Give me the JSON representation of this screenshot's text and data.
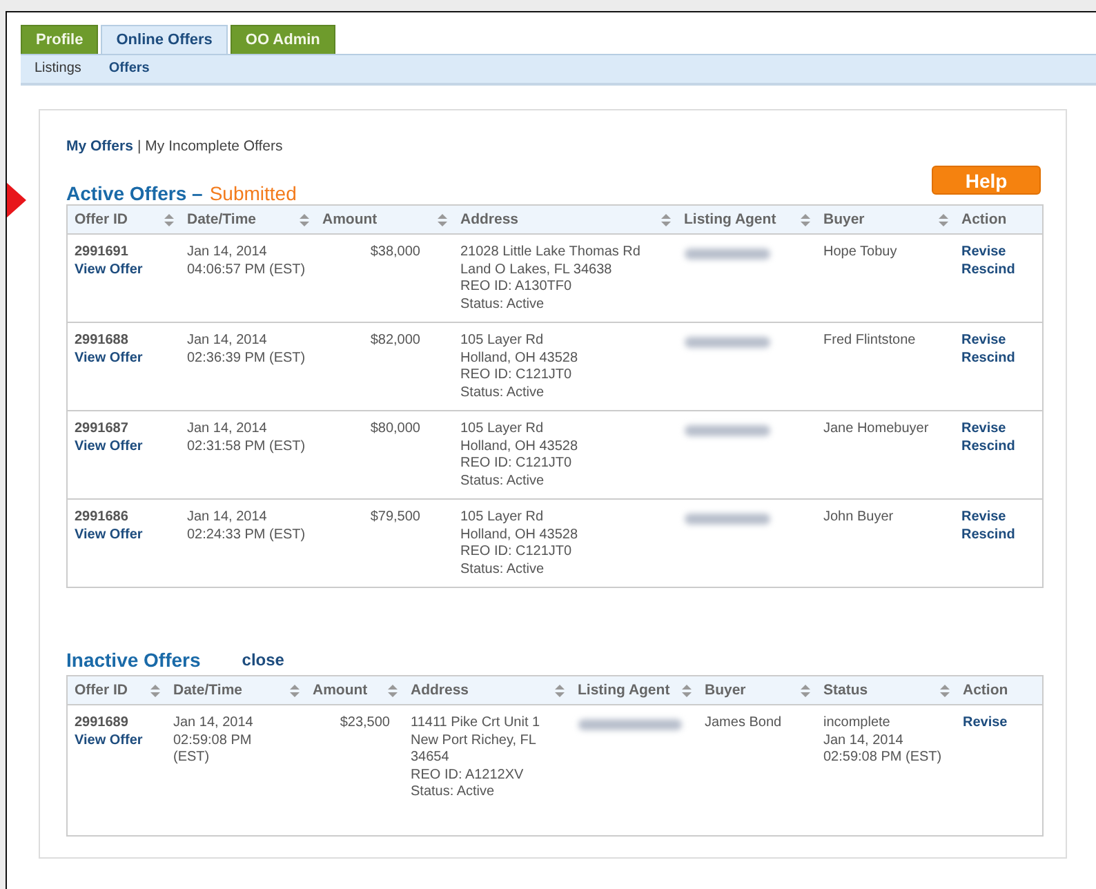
{
  "tabs": [
    {
      "label": "Profile",
      "selected": false
    },
    {
      "label": "Online Offers",
      "selected": true
    },
    {
      "label": "OO Admin",
      "selected": false
    }
  ],
  "subnav": [
    {
      "label": "Listings",
      "selected": false
    },
    {
      "label": "Offers",
      "selected": true
    }
  ],
  "offer_links": [
    {
      "label": "My Offers",
      "selected": true
    },
    {
      "label": "My Incomplete Offers",
      "selected": false
    }
  ],
  "separator": "|",
  "help_button": "Help",
  "active": {
    "title": "Active Offers –",
    "subtitle": "Submitted",
    "columns": [
      {
        "label": "Offer ID",
        "sortable": true
      },
      {
        "label": "Date/Time",
        "sortable": true
      },
      {
        "label": "Amount",
        "sortable": true
      },
      {
        "label": "Address",
        "sortable": true
      },
      {
        "label": "Listing Agent",
        "sortable": true
      },
      {
        "label": "Buyer",
        "sortable": true
      },
      {
        "label": "Action",
        "sortable": false
      }
    ],
    "rows": [
      {
        "offer_id": "2991691",
        "link": "View Offer",
        "date": [
          "Jan 14, 2014",
          "04:06:57 PM (EST)"
        ],
        "amount": "$38,000",
        "address": [
          "21028 Little Lake Thomas Rd",
          "Land O Lakes, FL 34638",
          "REO ID: A130TF0",
          "Status: Active"
        ],
        "buyer": "Hope Tobuy",
        "actions": [
          "Revise",
          "Rescind"
        ]
      },
      {
        "offer_id": "2991688",
        "link": "View Offer",
        "date": [
          "Jan 14, 2014",
          "02:36:39 PM (EST)"
        ],
        "amount": "$82,000",
        "address": [
          "105 Layer Rd",
          "Holland, OH 43528",
          "REO ID: C121JT0",
          "Status: Active"
        ],
        "buyer": "Fred Flintstone",
        "actions": [
          "Revise",
          "Rescind"
        ]
      },
      {
        "offer_id": "2991687",
        "link": "View Offer",
        "date": [
          "Jan 14, 2014",
          "02:31:58 PM (EST)"
        ],
        "amount": "$80,000",
        "address": [
          "105 Layer Rd",
          "Holland, OH 43528",
          "REO ID: C121JT0",
          "Status: Active"
        ],
        "buyer": "Jane Homebuyer",
        "actions": [
          "Revise",
          "Rescind"
        ]
      },
      {
        "offer_id": "2991686",
        "link": "View Offer",
        "date": [
          "Jan 14, 2014",
          "02:24:33 PM (EST)"
        ],
        "amount": "$79,500",
        "address": [
          "105 Layer Rd",
          "Holland, OH 43528",
          "REO ID: C121JT0",
          "Status: Active"
        ],
        "buyer": "John Buyer",
        "actions": [
          "Revise",
          "Rescind"
        ]
      }
    ]
  },
  "inactive": {
    "title": "Inactive Offers",
    "close_link": "close",
    "columns": [
      {
        "label": "Offer ID",
        "sortable": true
      },
      {
        "label": "Date/Time",
        "sortable": true
      },
      {
        "label": "Amount",
        "sortable": true
      },
      {
        "label": "Address",
        "sortable": true
      },
      {
        "label": "Listing Agent",
        "sortable": true
      },
      {
        "label": "Buyer",
        "sortable": true
      },
      {
        "label": "Status",
        "sortable": true
      },
      {
        "label": "Action",
        "sortable": false
      }
    ],
    "rows": [
      {
        "offer_id": "2991689",
        "link": "View Offer",
        "date": [
          "Jan 14, 2014",
          "02:59:08 PM",
          "(EST)"
        ],
        "amount": "$23,500",
        "address": [
          "11411 Pike Crt Unit 1",
          "New Port Richey, FL",
          "34654",
          "REO ID: A1212XV",
          "Status: Active"
        ],
        "buyer": "James Bond",
        "status": [
          "incomplete",
          "Jan 14, 2014",
          "02:59:08 PM (EST)"
        ],
        "actions": [
          "Revise"
        ]
      }
    ]
  }
}
